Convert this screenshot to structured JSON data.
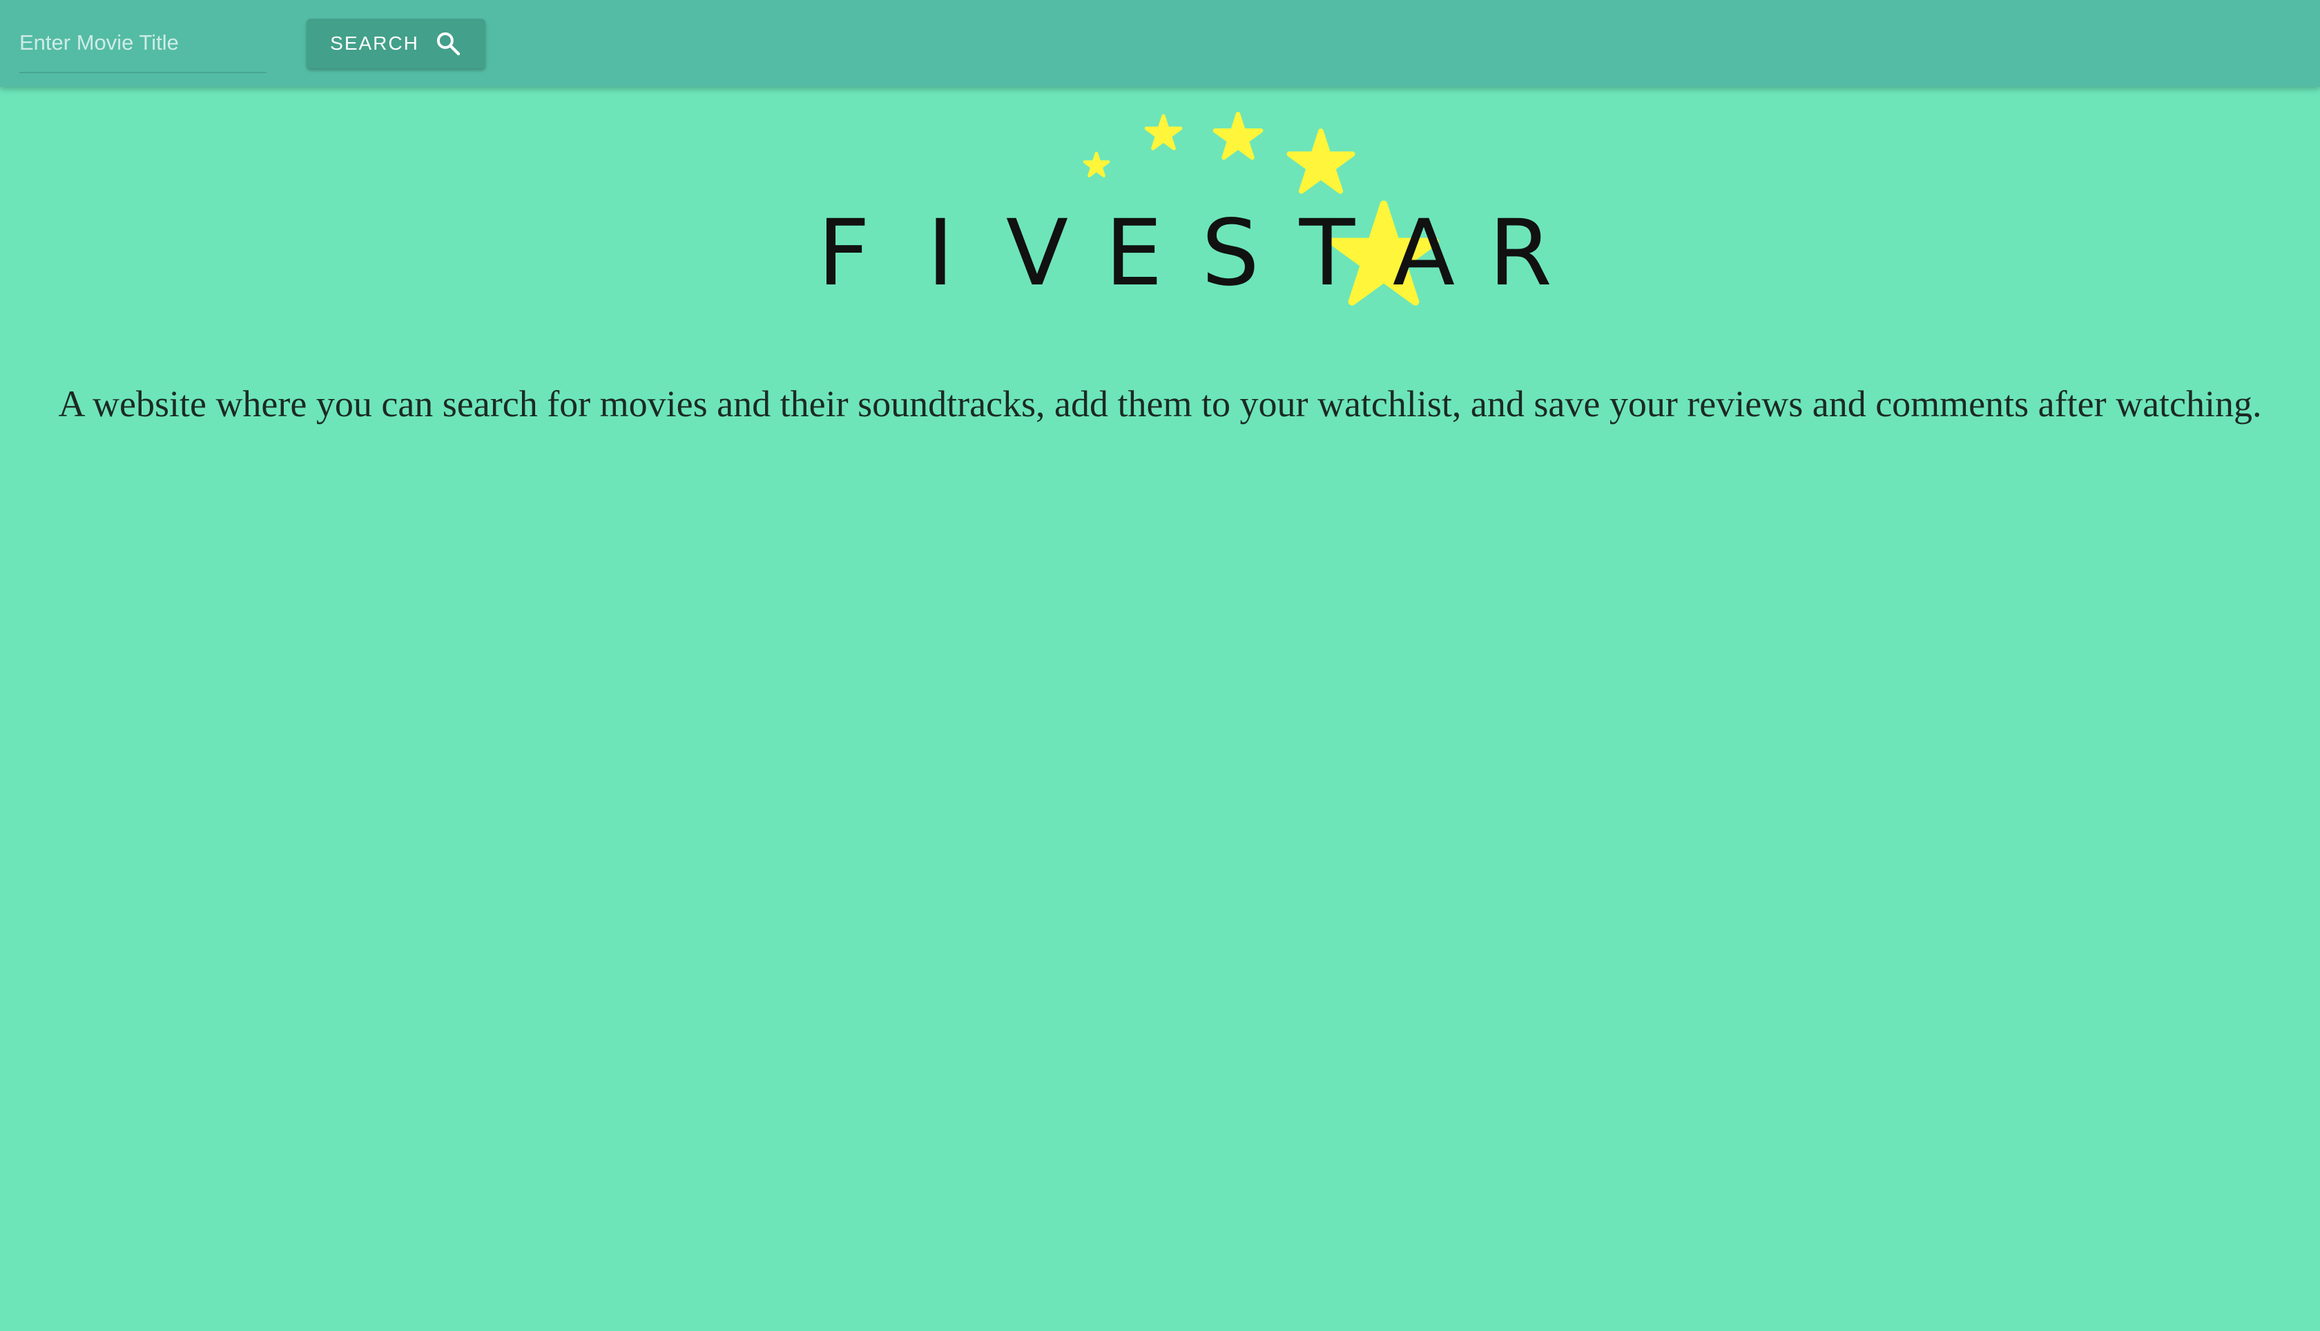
{
  "header": {
    "search": {
      "placeholder": "Enter Movie Title",
      "value": ""
    },
    "search_button": {
      "label": "SEARCH",
      "icon": "search-icon"
    }
  },
  "logo": {
    "letters": [
      "F",
      "I",
      "V",
      "E",
      "S",
      "T",
      "A",
      "R"
    ],
    "star_color": "#fff53a"
  },
  "main": {
    "tagline": "A website where you can search for movies and their soundtracks, add them to your watchlist, and save your reviews and comments after watching."
  },
  "colors": {
    "background": "#6de5b9",
    "header": "#54bca4",
    "button": "#43a08a"
  }
}
